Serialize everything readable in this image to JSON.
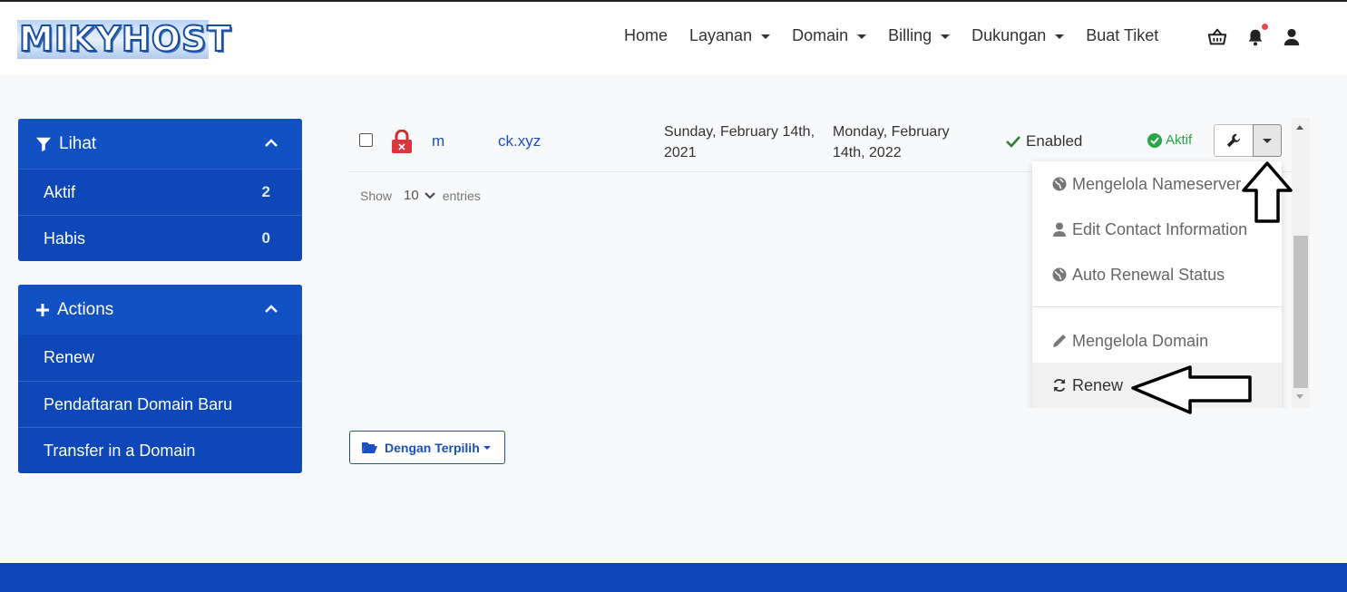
{
  "brand": {
    "logo_text": "MIKYHOST"
  },
  "nav": [
    {
      "label": "Home",
      "dropdown": false
    },
    {
      "label": "Layanan",
      "dropdown": true
    },
    {
      "label": "Domain",
      "dropdown": true
    },
    {
      "label": "Billing",
      "dropdown": true
    },
    {
      "label": "Dukungan",
      "dropdown": true
    },
    {
      "label": "Buat Tiket",
      "dropdown": false
    }
  ],
  "header_icons": [
    "basket-icon",
    "bell-icon",
    "user-icon"
  ],
  "sidebar": {
    "lihat": {
      "title": "Lihat",
      "items": [
        {
          "label": "Aktif",
          "count": "2"
        },
        {
          "label": "Habis",
          "count": "0"
        }
      ]
    },
    "actions": {
      "title": "Actions",
      "items": [
        {
          "label": "Renew"
        },
        {
          "label": "Pendaftaran Domain Baru"
        },
        {
          "label": "Transfer in a Domain"
        }
      ]
    }
  },
  "table": {
    "row": {
      "domain_start": "m",
      "domain_end": "ck.xyz",
      "registration_date": "Sunday, February 14th, 2021",
      "next_due_date": "Monday, February 14th, 2022",
      "auto_renew": "Enabled",
      "status": "Aktif"
    },
    "show_label": "Show",
    "entries_value": "10",
    "entries_label": "entries"
  },
  "dropdown_menu": [
    {
      "label": "Mengelola Nameserver",
      "icon": "globe-icon"
    },
    {
      "label": "Edit Contact Information",
      "icon": "user-icon"
    },
    {
      "label": "Auto Renewal Status",
      "icon": "globe-icon"
    },
    {
      "label": "Mengelola Domain",
      "icon": "pencil-icon"
    },
    {
      "label": "Renew",
      "icon": "refresh-icon"
    }
  ],
  "bulk_action": {
    "label": "Dengan Terpilih"
  },
  "colors": {
    "primary": "#0d47b8",
    "link": "#1c4fbf",
    "success": "#28a745",
    "notification": "#e5484d"
  }
}
